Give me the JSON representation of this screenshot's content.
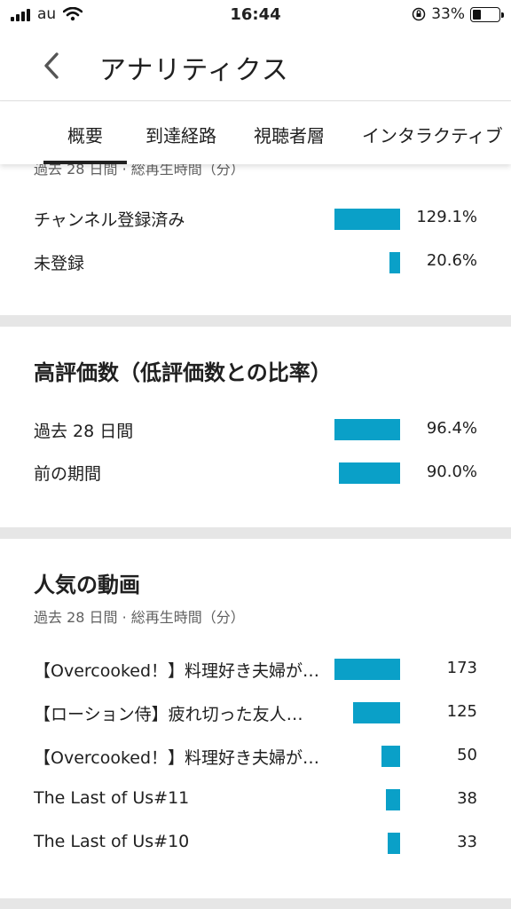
{
  "status_bar": {
    "carrier": "au",
    "time": "16:44",
    "battery": "33%",
    "battery_level": 0.33
  },
  "app_bar": {
    "title": "アナリティクス",
    "back_icon": "chevron-left-icon"
  },
  "tabs": [
    "概要",
    "到達経路",
    "視聴者層",
    "インタラクティブ"
  ],
  "selected_tab": "概要",
  "colors": {
    "bar": "#0aa0c8",
    "separator": "#e6e6e6",
    "text": "#202020",
    "subtext": "#606060"
  },
  "subscription_card": {
    "subtitle": "過去 28 日間 · 総再生時間（分）",
    "rows": [
      {
        "label": "チャンネル登録済み",
        "value": "129.1%",
        "fraction": 1.0
      },
      {
        "label": "未登録",
        "value": "20.6%",
        "fraction": 0.16
      }
    ]
  },
  "likes_card": {
    "title": "高評価数（低評価数との比率）",
    "rows": [
      {
        "label": "過去 28 日間",
        "value": "96.4%",
        "fraction": 1.0
      },
      {
        "label": "前の期間",
        "value": "90.0%",
        "fraction": 0.93
      }
    ]
  },
  "popular_card": {
    "title": "人気の動画",
    "subtitle": "過去 28 日間 · 総再生時間（分）",
    "rows": [
      {
        "label": "【Overcooked！】料理好き夫婦が…",
        "value": "173"
      },
      {
        "label": "【ローション侍】疲れ切った友人…",
        "value": "125"
      },
      {
        "label": "【Overcooked！】料理好き夫婦が…",
        "value": "50"
      },
      {
        "label": "The Last of Us#11",
        "value": "38"
      },
      {
        "label": "The Last of Us#10",
        "value": "33"
      }
    ]
  }
}
